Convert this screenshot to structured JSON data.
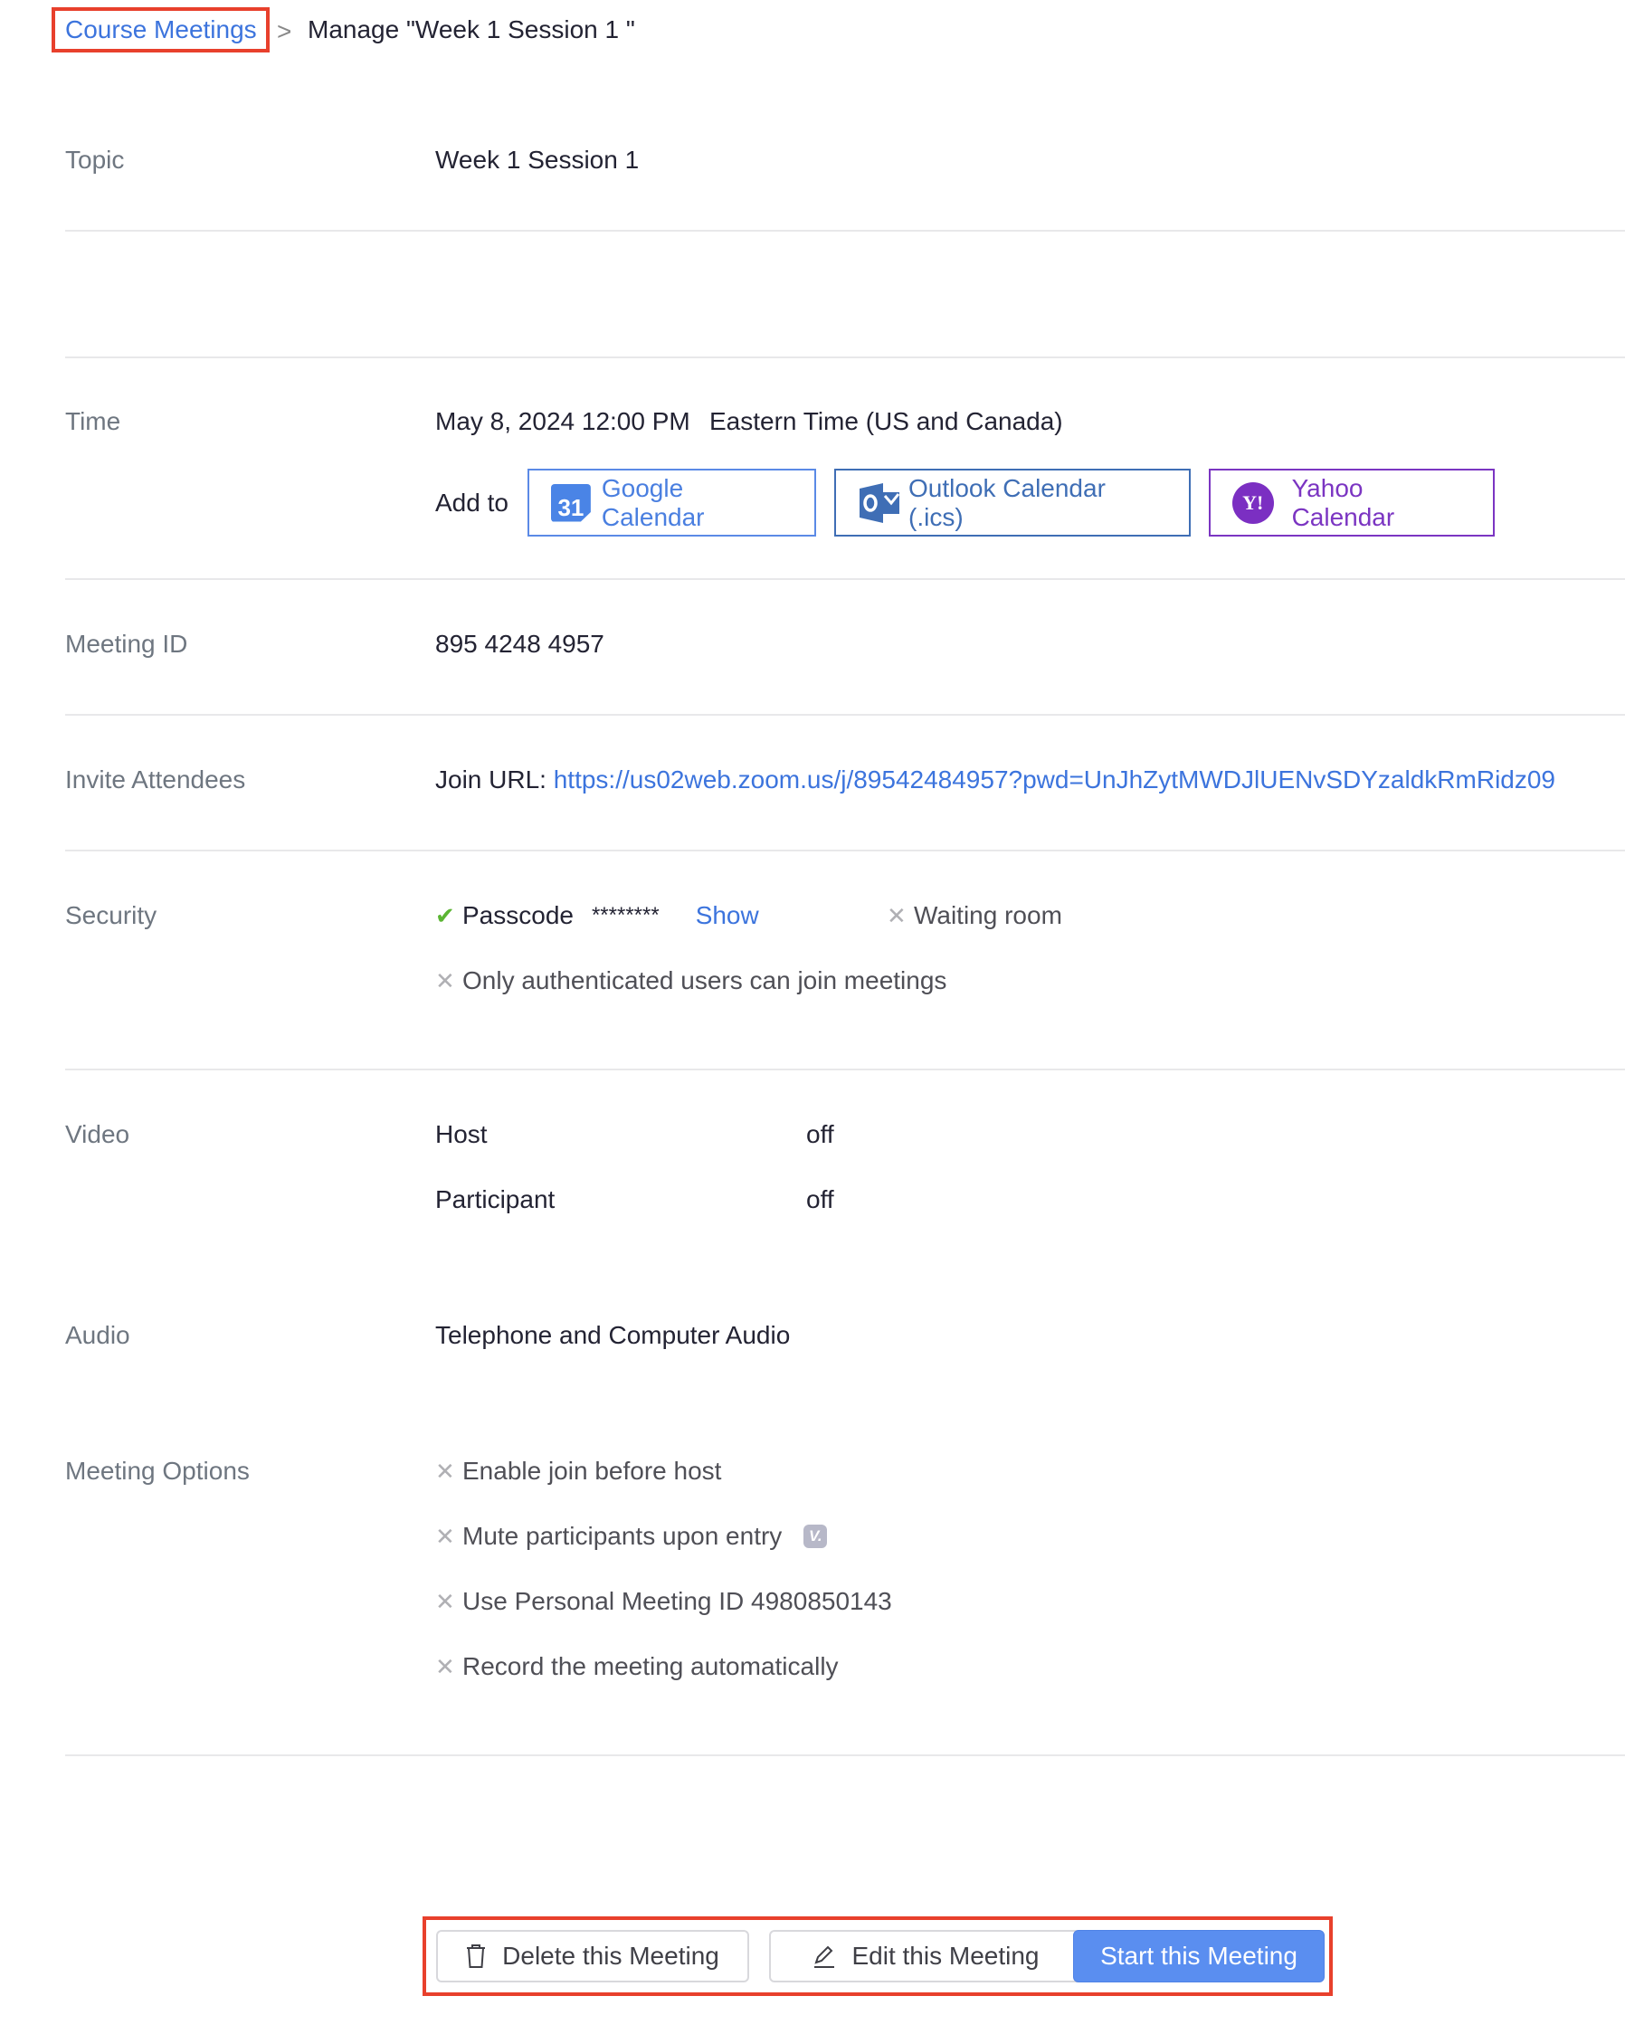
{
  "breadcrumb": {
    "parent": "Course Meetings",
    "separator": ">",
    "current": "Manage \"Week 1 Session 1 \""
  },
  "topic": {
    "label": "Topic",
    "value": "Week 1 Session 1"
  },
  "time": {
    "label": "Time",
    "value": "May 8, 2024 12:00 PM",
    "timezone": "Eastern Time (US and Canada)",
    "add_to_label": "Add to",
    "calendars": [
      {
        "label": "Google Calendar",
        "icon": "google-calendar-icon",
        "icon_text": "31",
        "color": "#4a7fe0"
      },
      {
        "label": "Outlook Calendar (.ics)",
        "icon": "outlook-icon",
        "icon_text": "O",
        "color": "#3f6eb5"
      },
      {
        "label": "Yahoo Calendar",
        "icon": "yahoo-icon",
        "icon_text": "Y!",
        "color": "#7b35c2"
      }
    ]
  },
  "meeting_id": {
    "label": "Meeting ID",
    "value": "895 4248 4957"
  },
  "invite": {
    "label": "Invite Attendees",
    "prefix": "Join URL:",
    "url": "https://us02web.zoom.us/j/89542484957?pwd=UnJhZytMWDJlUENvSDYzaldkRmRidz09"
  },
  "security": {
    "label": "Security",
    "passcode_label": "Passcode",
    "passcode_masked": "********",
    "show_label": "Show",
    "waiting_room_label": "Waiting room",
    "auth_label": "Only authenticated users can join meetings",
    "passcode_enabled": true,
    "waiting_room_enabled": false,
    "auth_enabled": false
  },
  "video": {
    "label": "Video",
    "rows": [
      {
        "name": "Host",
        "value": "off"
      },
      {
        "name": "Participant",
        "value": "off"
      }
    ]
  },
  "audio": {
    "label": "Audio",
    "value": "Telephone and Computer Audio"
  },
  "options": {
    "label": "Meeting Options",
    "items": [
      {
        "label": "Enable join before host",
        "enabled": false
      },
      {
        "label": "Mute participants upon entry",
        "enabled": false,
        "badge": "V."
      },
      {
        "label": "Use Personal Meeting ID 4980850143",
        "enabled": false
      },
      {
        "label": "Record the meeting automatically",
        "enabled": false
      }
    ]
  },
  "actions": {
    "delete_label": "Delete this Meeting",
    "edit_label": "Edit this Meeting",
    "start_label": "Start this Meeting"
  },
  "colors": {
    "link": "#3c74dd",
    "primary_button": "#5a8ef0",
    "highlight_box": "#e8402c",
    "check": "#5bb533"
  }
}
